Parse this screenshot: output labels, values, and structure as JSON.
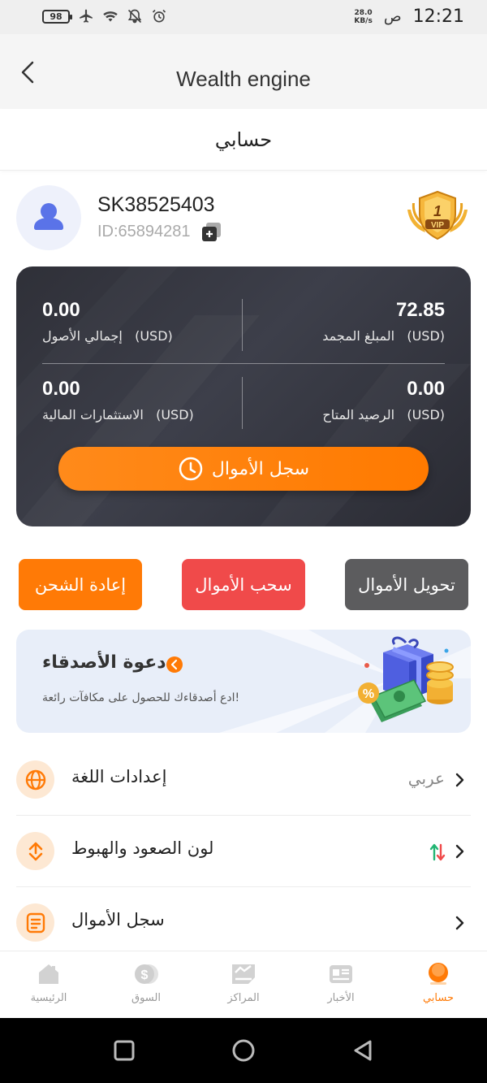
{
  "status_bar": {
    "battery": "98",
    "net_speed_value": "28.0",
    "net_speed_unit": "KB/s",
    "ampm": "ص",
    "time": "12:21"
  },
  "header": {
    "title": "Wealth engine"
  },
  "page": {
    "title": "حسابي"
  },
  "profile": {
    "username": "SK38525403",
    "user_id": "ID:65894281",
    "vip_level": "1",
    "vip_text": "VIP"
  },
  "balance_card": {
    "stats": [
      {
        "value": "0.00",
        "currency": "(USD)",
        "label": "إجمالي الأصول"
      },
      {
        "value": "72.85",
        "currency": "(USD)",
        "label": "المبلغ المجمد"
      },
      {
        "value": "0.00",
        "currency": "(USD)",
        "label": "الاستثمارات المالية"
      },
      {
        "value": "0.00",
        "currency": "(USD)",
        "label": "الرصيد المتاح"
      }
    ],
    "ledger_button": "سجل الأموال"
  },
  "actions": {
    "recharge": "إعادة الشحن",
    "withdraw": "سحب الأموال",
    "transfer": "تحويل الأموال"
  },
  "invite": {
    "title": "دعوة الأصدقاء",
    "description": "ادع أصدقاءك للحصول على مكافآت رائعة!"
  },
  "settings": [
    {
      "label": "إعدادات اللغة",
      "value": "عربي",
      "icon": "globe-icon"
    },
    {
      "label": "لون الصعود والهبوط",
      "value": "",
      "icon": "swap-icon"
    },
    {
      "label": "سجل الأموال",
      "value": "",
      "icon": "document-icon"
    }
  ],
  "tabs": [
    {
      "label": "الرئيسية",
      "icon": "home-icon"
    },
    {
      "label": "السوق",
      "icon": "dollar-coin-icon"
    },
    {
      "label": "المراكز",
      "icon": "positions-icon"
    },
    {
      "label": "الأخبار",
      "icon": "news-icon"
    },
    {
      "label": "حسابي",
      "icon": "profile-icon",
      "active": true
    }
  ],
  "colors": {
    "accent": "#ff7a06",
    "withdraw": "#f04a4a",
    "transfer": "#5c5c5e",
    "card": "#2f3038",
    "up": "#22b573",
    "down": "#f04a4a"
  }
}
